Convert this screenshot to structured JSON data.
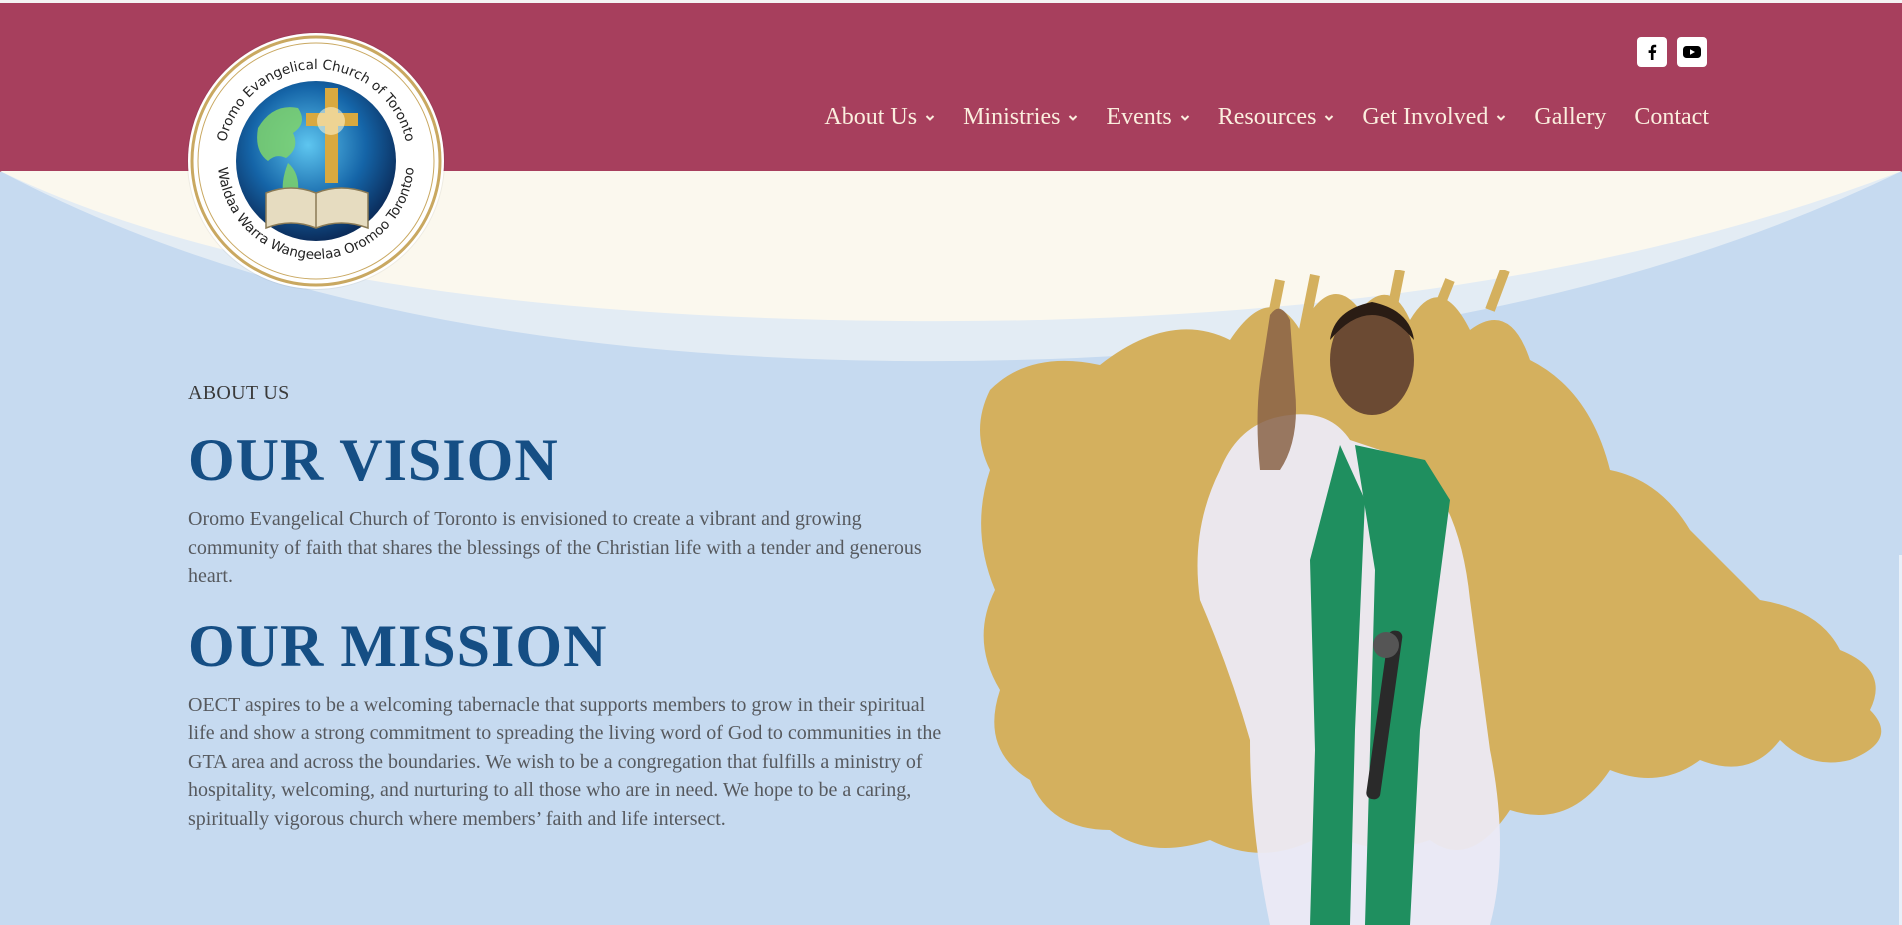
{
  "logo": {
    "top_text": "Oromo Evangelical Church of Toronto",
    "bottom_text": "Waldaa Warra Wangeelaa Oromoo Torontoo"
  },
  "social": [
    {
      "name": "facebook",
      "icon": "facebook-icon"
    },
    {
      "name": "youtube",
      "icon": "youtube-icon"
    }
  ],
  "nav": {
    "items": [
      {
        "label": "About Us",
        "has_dropdown": true
      },
      {
        "label": "Ministries",
        "has_dropdown": true
      },
      {
        "label": "Events",
        "has_dropdown": true
      },
      {
        "label": "Resources",
        "has_dropdown": true
      },
      {
        "label": "Get Involved",
        "has_dropdown": true
      },
      {
        "label": "Gallery",
        "has_dropdown": false
      },
      {
        "label": "Contact",
        "has_dropdown": false
      }
    ]
  },
  "content": {
    "eyebrow": "ABOUT US",
    "vision_title": "OUR VISION",
    "vision_text": "Oromo Evangelical Church of Toronto is envisioned to create a vibrant and growing community of faith that shares the blessings of the Christian life with a tender and generous heart.",
    "mission_title": "OUR MISSION",
    "mission_text": "OECT aspires to be a welcoming tabernacle that supports members to grow in their spiritual life and show a strong commitment to spreading the living word of God to communities in the GTA area and across the boundaries. We wish to be a congregation that fulfills a ministry of hospitality, welcoming, and nurturing to all those who are in need. We hope to be a caring, spiritually vigorous church where members’ faith and life intersect."
  },
  "colors": {
    "header": "#a73f5d",
    "background": "#c6daf0",
    "cream": "#fbf8ee",
    "title_blue": "#154e84",
    "gold": "#d4b05e",
    "nav_text": "#fbeede",
    "stole_green": "#1f8f5f"
  }
}
